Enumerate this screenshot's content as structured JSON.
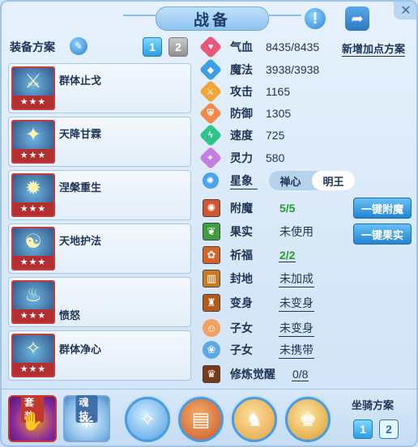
{
  "header": {
    "title": "战备",
    "help_glyph": "!",
    "share_glyph": "➦",
    "close_glyph": "✕"
  },
  "left": {
    "scheme_label": "装备方案",
    "scheme_tabs": [
      "1",
      "2"
    ],
    "active_scheme": "1",
    "skills": [
      {
        "name": "群体止戈",
        "stars": "★★★",
        "icon": "spear-icon",
        "glyph": "⚔"
      },
      {
        "name": "天降甘霖",
        "stars": "★★★",
        "icon": "staff-icon",
        "glyph": "✦"
      },
      {
        "name": "涅槃重生",
        "stars": "★★★",
        "icon": "phoenix-icon",
        "glyph": "✹"
      },
      {
        "name": "天地护法",
        "stars": "★★★",
        "icon": "serpent-icon",
        "glyph": "☯"
      },
      {
        "name": "愤怒",
        "stars": "★★★",
        "icon": "flame-bowl-icon",
        "glyph": "♨"
      },
      {
        "name": "群体净心",
        "stars": "★★★",
        "icon": "sword-icon",
        "glyph": "✧"
      }
    ]
  },
  "right": {
    "add_scheme_label": "新增加点方案",
    "stats": [
      {
        "label": "气血",
        "value": "8435/8435",
        "color": "#e8577a",
        "glyph": "♥"
      },
      {
        "label": "魔法",
        "value": "3938/3938",
        "color": "#3b9fe8",
        "glyph": "◆"
      },
      {
        "label": "攻击",
        "value": "1165",
        "color": "#f0a63a",
        "glyph": "⚔"
      },
      {
        "label": "防御",
        "value": "1305",
        "color": "#f08a4a",
        "glyph": "⛨"
      },
      {
        "label": "速度",
        "value": "725",
        "color": "#2ec48a",
        "glyph": "ϟ"
      },
      {
        "label": "灵力",
        "value": "580",
        "color": "#c27ee0",
        "glyph": "✦"
      }
    ],
    "star": {
      "label": "星象",
      "tabs": [
        "禅心",
        "明王"
      ],
      "active": "明王"
    },
    "extras": [
      {
        "label": "附魔",
        "value": "5/5",
        "style": "green",
        "color": "#d2562c",
        "glyph": "✺"
      },
      {
        "label": "果实",
        "value": "未使用",
        "style": "plain",
        "color": "#3f9c3f",
        "glyph": "❦"
      },
      {
        "label": "祈福",
        "value": "2/2",
        "style": "green",
        "color": "#d8622a",
        "glyph": "✿"
      },
      {
        "label": "封地",
        "value": "未加成",
        "style": "underline",
        "color": "#c77a20",
        "glyph": "▥"
      },
      {
        "label": "变身",
        "value": "未变身",
        "style": "underline",
        "color": "#b45a1a",
        "glyph": "♜"
      },
      {
        "label": "子女",
        "value": "未变身",
        "style": "underline",
        "color": "#f0a060",
        "glyph": "☺"
      },
      {
        "label": "子女",
        "value": "未携带",
        "style": "underline",
        "color": "#5aa9e6",
        "glyph": "❀"
      },
      {
        "label": "修炼觉醒",
        "value": "0/8",
        "style": "underline",
        "color": "#7a3a1a",
        "glyph": "♛"
      }
    ],
    "actions": {
      "enchant": "一键附魔",
      "fruit": "一键果实"
    }
  },
  "bottom": {
    "set_label": "套装",
    "skill_label": "魂技",
    "mount_label": "坐骑方案",
    "mount_tabs": [
      "1",
      "2"
    ],
    "active_mount": "1",
    "orbs": [
      {
        "icon": "spirit-orb-icon",
        "glyph": "✧",
        "color": "#4a9be0"
      },
      {
        "icon": "scroll-orb-icon",
        "glyph": "▤",
        "color": "#c9552a"
      },
      {
        "icon": "warrior-orb-icon",
        "glyph": "♞",
        "color": "#e0a040"
      },
      {
        "icon": "golden-warrior-orb-icon",
        "glyph": "♚",
        "color": "#d89a2a"
      }
    ]
  }
}
